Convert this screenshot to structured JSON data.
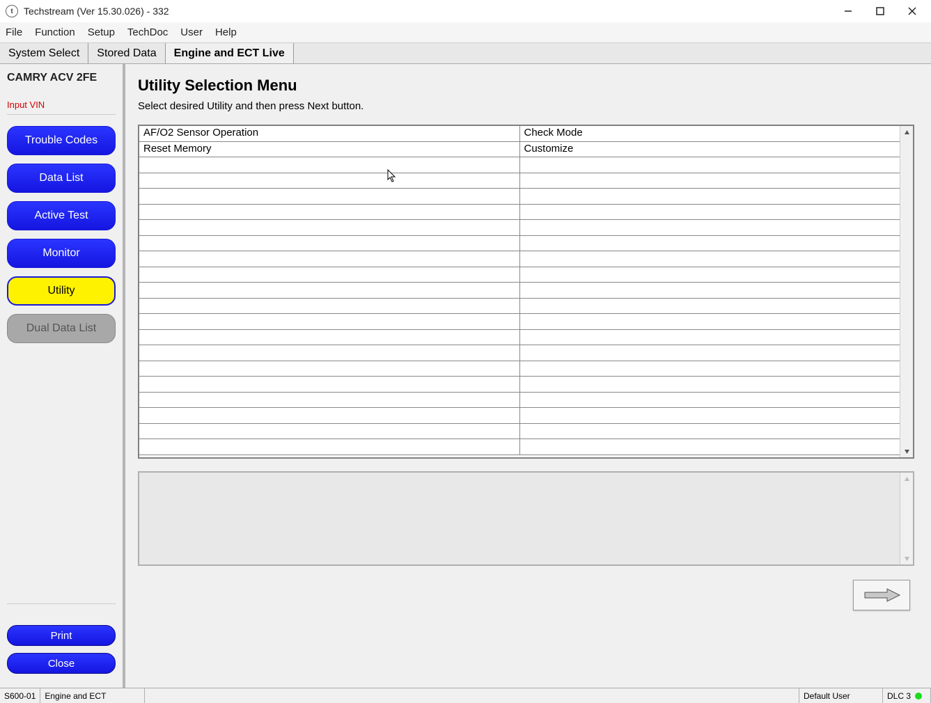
{
  "window": {
    "title": "Techstream (Ver 15.30.026) - 332"
  },
  "menu": {
    "items": [
      "File",
      "Function",
      "Setup",
      "TechDoc",
      "User",
      "Help"
    ]
  },
  "tabs": [
    {
      "label": "System Select",
      "active": false
    },
    {
      "label": "Stored Data",
      "active": false
    },
    {
      "label": "Engine and ECT Live",
      "active": true
    }
  ],
  "sidebar": {
    "vehicle": "CAMRY ACV 2FE",
    "input_vin": "Input VIN",
    "nav": [
      {
        "label": "Trouble Codes",
        "style": "blue"
      },
      {
        "label": "Data List",
        "style": "blue"
      },
      {
        "label": "Active Test",
        "style": "blue"
      },
      {
        "label": "Monitor",
        "style": "blue"
      },
      {
        "label": "Utility",
        "style": "yellow"
      },
      {
        "label": "Dual Data List",
        "style": "disabled"
      }
    ],
    "print": "Print",
    "close": "Close"
  },
  "main": {
    "heading": "Utility Selection Menu",
    "subtitle": "Select desired Utility and then press Next button.",
    "grid": {
      "rows": [
        [
          "AF/O2 Sensor Operation",
          "Check Mode"
        ],
        [
          "Reset Memory",
          "Customize"
        ],
        [
          "",
          ""
        ],
        [
          "",
          ""
        ],
        [
          "",
          ""
        ],
        [
          "",
          ""
        ],
        [
          "",
          ""
        ],
        [
          "",
          ""
        ],
        [
          "",
          ""
        ],
        [
          "",
          ""
        ],
        [
          "",
          ""
        ],
        [
          "",
          ""
        ],
        [
          "",
          ""
        ],
        [
          "",
          ""
        ],
        [
          "",
          ""
        ],
        [
          "",
          ""
        ],
        [
          "",
          ""
        ],
        [
          "",
          ""
        ],
        [
          "",
          ""
        ],
        [
          "",
          ""
        ],
        [
          "",
          ""
        ]
      ]
    }
  },
  "statusbar": {
    "code": "S600-01",
    "system": "Engine and ECT",
    "user": "Default User",
    "conn": "DLC 3"
  }
}
